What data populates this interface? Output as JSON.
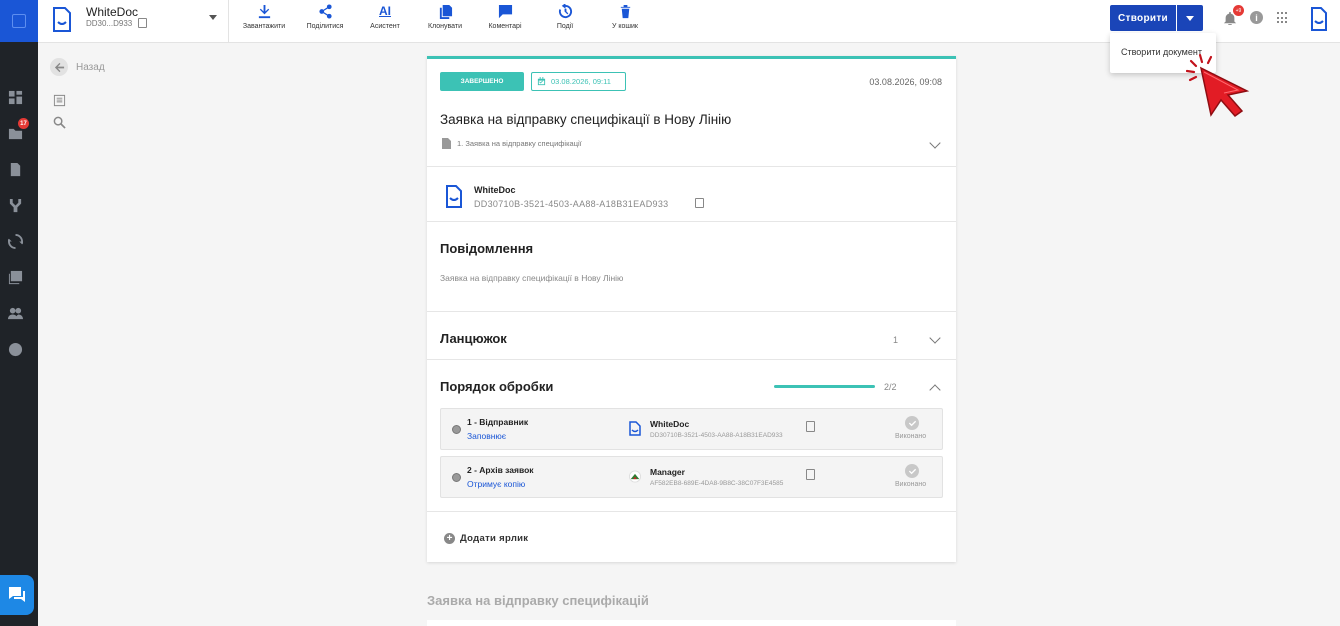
{
  "topbar": {
    "doc_title": "WhiteDoc",
    "doc_id": "DD30...D933",
    "toolbar": [
      {
        "label": "Завантажити",
        "icon": "download-icon"
      },
      {
        "label": "Поділитися",
        "icon": "share-icon"
      },
      {
        "label": "Асистент",
        "icon": "ai-icon",
        "glyph": "AI"
      },
      {
        "label": "Клонувати",
        "icon": "clone-icon"
      },
      {
        "label": "Коментарі",
        "icon": "comment-icon"
      },
      {
        "label": "Події",
        "icon": "history-icon"
      },
      {
        "label": "У кошик",
        "icon": "trash-icon"
      }
    ],
    "create_label": "Створити",
    "bell_badge": "+9",
    "info_glyph": "i"
  },
  "dropdown": {
    "item": "Створити документ"
  },
  "sidebar": {
    "badge": "17"
  },
  "back": {
    "label": "Назад"
  },
  "card": {
    "status": "ЗАВЕРШЕНО",
    "date_chip": "03.08.2026, 09:11",
    "date_right": "03.08.2026, 09:08",
    "title": "Заявка на відправку специфікації в Нову Лінію",
    "sub_doc": "1. Заявка на відправку специфікації",
    "org_name": "WhiteDoc",
    "org_id": "DD30710B-3521-4503-AA88-A18B31EAD933",
    "message_title": "Повідомлення",
    "message_text": "Заявка на відправку специфікації в Нову Лінію",
    "chain_title": "Ланцюжок",
    "chain_count": "1",
    "order_title": "Порядок обробки",
    "order_count": "2/2",
    "order_progress": 1.0,
    "rows": [
      {
        "role": "1 - Відправник",
        "action": "Заповнює",
        "name": "WhiteDoc",
        "id": "DD30710B-3521-4503-AA88-A18B31EAD933",
        "status": "Виконано"
      },
      {
        "role": "2 - Архів заявок",
        "action": "Отримує копію",
        "name": "Manager",
        "id": "AF582EB8-689E-4DA8-9B8C-38C07F3E4585",
        "status": "Виконано"
      }
    ],
    "add_label": "Додати ярлик"
  },
  "bottom": {
    "title": "Заявка на відправку специфікацій"
  },
  "colors": {
    "accent": "#1a56d6",
    "teal": "#3cc2b5",
    "rail": "#1f2328",
    "create": "#1a45b8",
    "badge": "#e53935"
  }
}
